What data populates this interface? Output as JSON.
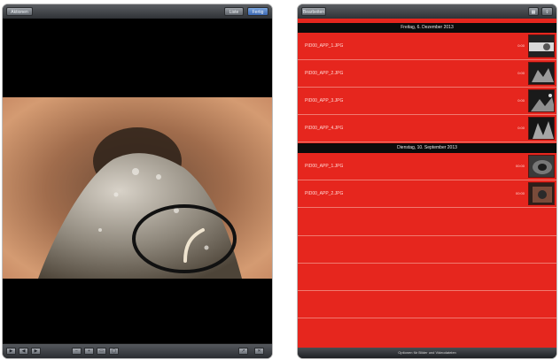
{
  "left": {
    "back_label": "Aktionen",
    "right_buttons": [
      "Liste",
      "Fertig"
    ],
    "toolbar_buttons": [
      {
        "icon": "play-icon",
        "glyph": "▶"
      },
      {
        "icon": "rewind-icon",
        "glyph": "◀"
      },
      {
        "icon": "forward-icon",
        "glyph": "▶"
      },
      {
        "icon": "zoom-out-icon",
        "glyph": "−"
      },
      {
        "icon": "zoom-in-icon",
        "glyph": "+"
      },
      {
        "icon": "crop-icon",
        "glyph": "▭"
      },
      {
        "icon": "mark-icon",
        "glyph": "◯"
      },
      {
        "icon": "share-icon",
        "glyph": "↗"
      },
      {
        "icon": "trash-icon",
        "glyph": "✕"
      }
    ]
  },
  "right": {
    "edit_label": "Bearbeiten",
    "sections": [
      {
        "title": "Freitag, 6. Dezember 2013",
        "files": [
          {
            "name": "PID00_APP_1.JPG",
            "time": "0:00"
          },
          {
            "name": "PID00_APP_2.JPG",
            "time": "0:00"
          },
          {
            "name": "PID00_APP_3.JPG",
            "time": "0:00"
          },
          {
            "name": "PID00_APP_4.JPG",
            "time": "0:00"
          }
        ]
      },
      {
        "title": "Dienstag, 10. September 2013",
        "files": [
          {
            "name": "PID00_APP_1.JPG",
            "time": "00:00"
          },
          {
            "name": "PID00_APP_2.JPG",
            "time": "00:00"
          }
        ]
      }
    ],
    "status_text": "Optionen für Bilder und Videodateien"
  },
  "colors": {
    "list_red": "#e6261e",
    "pipe_tan": "#c98a5f"
  }
}
